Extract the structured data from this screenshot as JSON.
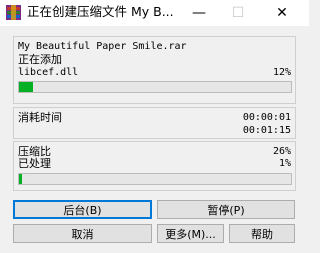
{
  "window": {
    "title": "正在创建压缩文件 My B...",
    "minimize_glyph": "—",
    "maximize_glyph": "☐",
    "close_glyph": "✕"
  },
  "file_panel": {
    "archive_name": "My Beautiful Paper Smile.rar",
    "status_label": "正在添加",
    "current_file": "libcef.dll",
    "current_file_percent": "12%",
    "progress_fraction": 0.05
  },
  "time_panel": {
    "elapsed_label": "消耗时间",
    "elapsed_value": "00:00:01",
    "remaining_value": "00:01:15"
  },
  "ratio_panel": {
    "ratio_label": "压缩比",
    "ratio_value": "26%",
    "processed_label": "已处理",
    "processed_value": "1%",
    "progress_fraction": 0.01
  },
  "buttons": {
    "background": "后台(B)",
    "pause": "暂停(P)",
    "cancel": "取消",
    "more": "更多(M)...",
    "help": "帮助"
  },
  "colors": {
    "progress_fill": "#06b025",
    "default_button_border": "#0078d7"
  }
}
